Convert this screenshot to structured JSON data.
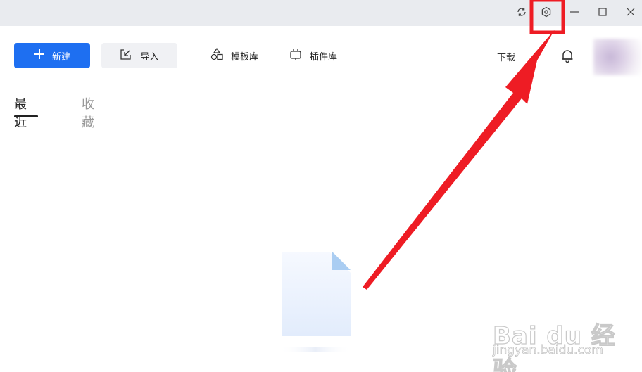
{
  "toolbar": {
    "new_label": "新建",
    "import_label": "导入",
    "templates_label": "模板库",
    "plugins_label": "插件库",
    "download_label": "下载"
  },
  "tabs": [
    {
      "label": "最近",
      "active": true
    },
    {
      "label": "收藏",
      "active": false
    }
  ],
  "colors": {
    "accent": "#1e6ff1",
    "titlebar": "#e9ebef",
    "annotation": "#ee1c24"
  },
  "icons": {
    "titlebar": [
      "sync-icon",
      "settings-gear-icon",
      "minimize-icon",
      "maximize-icon",
      "close-icon"
    ],
    "toolbar": [
      "plus-icon",
      "import-icon",
      "shapes-icon",
      "plugin-icon",
      "bell-icon"
    ]
  },
  "watermark": {
    "line1": "Bai du 经验",
    "line2": "jingyan.baidu.com"
  }
}
